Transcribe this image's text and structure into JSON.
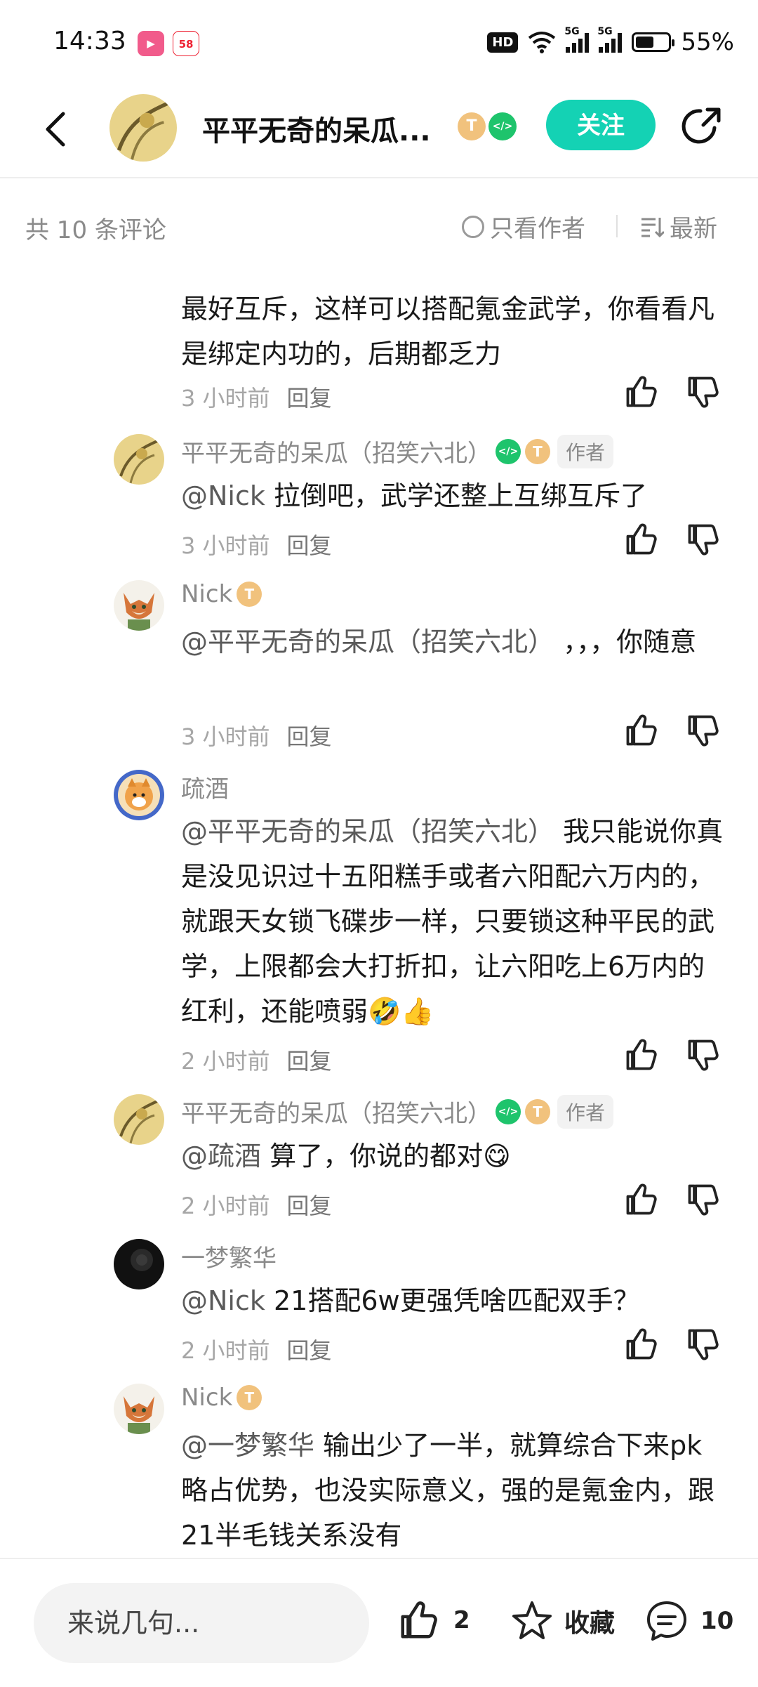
{
  "status_bar": {
    "time": "14:33",
    "apps": [
      "bilibili",
      "58"
    ],
    "hd_label": "HD",
    "network_1": "5G",
    "network_2": "5G",
    "battery_percent": "55%",
    "battery_level": 0.55
  },
  "header": {
    "title": "平平无奇的呆瓜...",
    "level_badge": "T",
    "follow_label": "关注"
  },
  "comment_bar": {
    "count_label": "共 10 条评论",
    "only_author_label": "只看作者",
    "sort_label": "最新"
  },
  "comments": [
    {
      "text": "最好互斥，这样可以搭配氪金武学，你看看凡是绑定内功的，后期都乏力",
      "time": "3 小时前",
      "reply_label": "回复"
    },
    {
      "name": "平平无奇的呆瓜（招笑六北）",
      "level": "T",
      "author_tag": "作者",
      "mention": "@Nick",
      "text": "拉倒吧，武学还整上互绑互斥了",
      "time": "3 小时前",
      "reply_label": "回复"
    },
    {
      "name": "Nick",
      "level": "T",
      "mention": "@平平无奇的呆瓜（招笑六北）",
      "text": "，，，你随意",
      "time": "3 小时前",
      "reply_label": "回复"
    },
    {
      "name": "疏酒",
      "mention": "@平平无奇的呆瓜（招笑六北）",
      "text": "我只能说你真是没见识过十五阳糕手或者六阳配六万内的，就跟天女锁飞碟步一样，只要锁这种平民的武学，上限都会大打折扣，让六阳吃上6万内的红利，还能喷弱🤣👍",
      "time": "2 小时前",
      "reply_label": "回复"
    },
    {
      "name": "平平无奇的呆瓜（招笑六北）",
      "level": "T",
      "author_tag": "作者",
      "mention": "@疏酒",
      "text": "算了，你说的都对😋",
      "time": "2 小时前",
      "reply_label": "回复"
    },
    {
      "name": "一梦繁华",
      "mention": "@Nick",
      "text": "21搭配6w更强凭啥匹配双手？",
      "time": "2 小时前",
      "reply_label": "回复"
    },
    {
      "name": "Nick",
      "level": "T",
      "mention": "@一梦繁华",
      "text": "输出少了一半，就算综合下来pk略占优势，也没实际意义，强的是氪金内，跟21半毛钱关系没有"
    }
  ],
  "bottom_bar": {
    "input_placeholder": "来说几句...",
    "like_count": "2",
    "favorite_label": "收藏",
    "comment_count": "10"
  },
  "icons": [
    "back-arrow-icon",
    "share-icon",
    "thumb-up-icon",
    "thumb-down-icon",
    "star-icon",
    "comment-bubble-icon",
    "sort-icon"
  ],
  "colors": {
    "accent": "#14d2b4",
    "muted_text": "#8a8a8a",
    "dev_badge": "#1ec46c",
    "level_badge": "#f1c27d"
  }
}
